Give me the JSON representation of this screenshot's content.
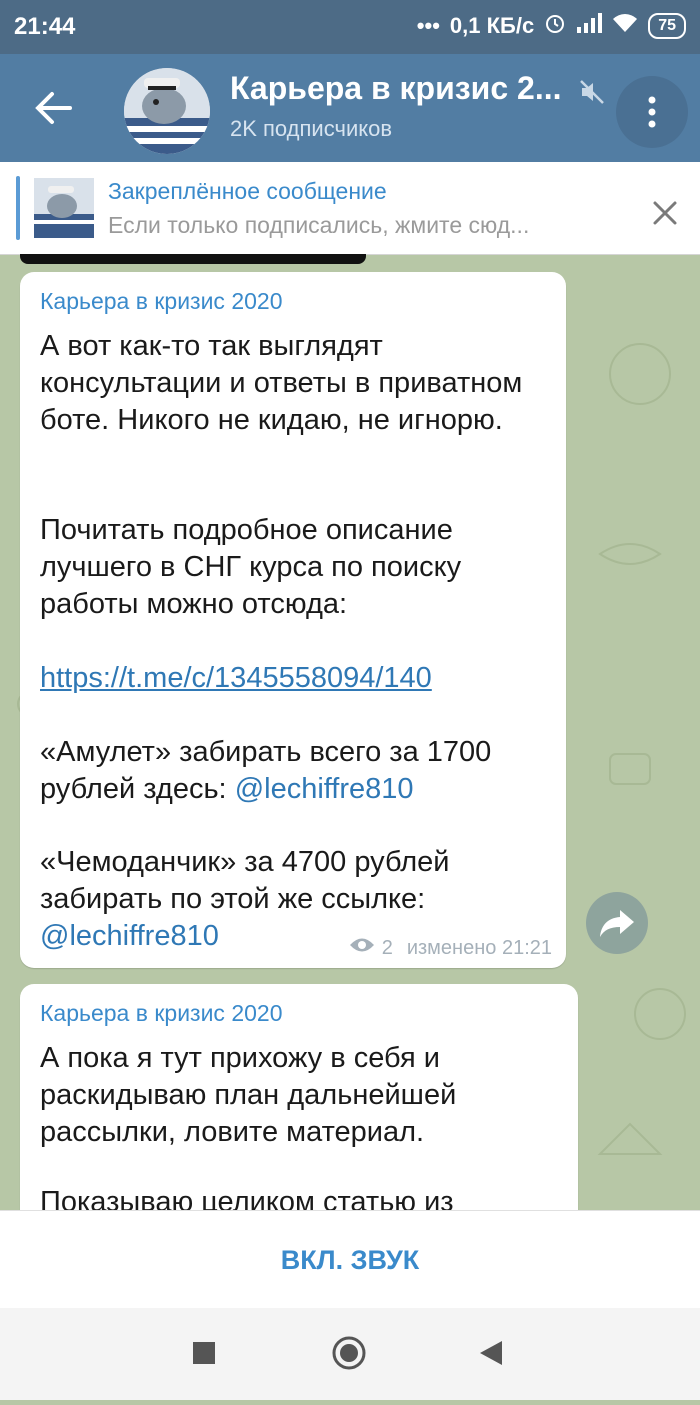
{
  "status_bar": {
    "time": "21:44",
    "network_speed": "0,1 КБ/с",
    "battery": "75",
    "icons": [
      "alarm-icon",
      "signal-icon",
      "wifi-icon",
      "battery-icon"
    ]
  },
  "header": {
    "title": "Карьера в кризис 2...",
    "subtitle": "2K подписчиков",
    "icons": [
      "back-arrow-icon",
      "mute-icon",
      "more-icon"
    ]
  },
  "pinned": {
    "title": "Закреплённое сообщение",
    "text": "Если только подписались, жмите сюд..."
  },
  "messages": [
    {
      "author": "Карьера в кризис 2020",
      "p1": "А вот как-то так выглядят консультации и ответы в приватном боте. Никого не кидаю, не игнорю.",
      "p2": "Почитать подробное описание лучшего в СНГ курса по поиску работы можно отсюда:",
      "link": "https://t.me/c/1345558094/140",
      "p3_prefix": "«Амулет» забирать всего за 1700 рублей здесь: ",
      "p3_mention": "@lechiffre810",
      "p4_prefix": "«Чемоданчик» за 4700 рублей забирать по этой же ссылке: ",
      "p4_mention": "@lechiffre810",
      "views": "2",
      "edited": "изменено 21:21"
    },
    {
      "author": "Карьера в кризис 2020",
      "p1": "А пока я тут прихожу в себя и раскидываю план дальнейшей рассылки, ловите материал.",
      "p2": "Показываю целиком статью из"
    }
  ],
  "bottom": {
    "sound_button": "ВКЛ. ЗВУК"
  },
  "colors": {
    "header": "#527da3",
    "accent": "#3a8acb",
    "chat_background": "#b7c7a6"
  }
}
